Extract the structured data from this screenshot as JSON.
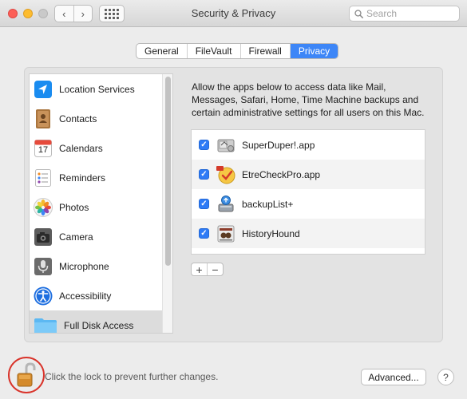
{
  "window": {
    "title": "Security & Privacy",
    "back_label": "‹",
    "forward_label": "›",
    "search_placeholder": "Search"
  },
  "tabs": [
    {
      "label": "General",
      "active": false
    },
    {
      "label": "FileVault",
      "active": false
    },
    {
      "label": "Firewall",
      "active": false
    },
    {
      "label": "Privacy",
      "active": true
    }
  ],
  "sidebar": {
    "selected": "Full Disk Access",
    "items": [
      {
        "label": "Location Services",
        "icon": "location-arrow-icon"
      },
      {
        "label": "Contacts",
        "icon": "contacts-book-icon"
      },
      {
        "label": "Calendars",
        "icon": "calendar-icon"
      },
      {
        "label": "Reminders",
        "icon": "reminders-list-icon"
      },
      {
        "label": "Photos",
        "icon": "photos-flower-icon"
      },
      {
        "label": "Camera",
        "icon": "camera-icon"
      },
      {
        "label": "Microphone",
        "icon": "microphone-icon"
      },
      {
        "label": "Accessibility",
        "icon": "accessibility-icon"
      },
      {
        "label": "Full Disk Access",
        "icon": "folder-icon"
      }
    ]
  },
  "calendar_icon_day": "17",
  "description": "Allow the apps below to access data like Mail, Messages, Safari, Home, Time Machine backups and certain administrative settings for all users on this Mac.",
  "apps": [
    {
      "name": "SuperDuper!.app",
      "checked": true,
      "icon": "superduper-app-icon"
    },
    {
      "name": "EtreCheckPro.app",
      "checked": true,
      "icon": "etrecheck-app-icon"
    },
    {
      "name": "backupList+",
      "checked": true,
      "icon": "backuplist-app-icon"
    },
    {
      "name": "HistoryHound",
      "checked": true,
      "icon": "historyhound-app-icon"
    }
  ],
  "add_label": "+",
  "remove_label": "−",
  "lock_text": "Click the lock to prevent further changes.",
  "advanced_label": "Advanced...",
  "help_label": "?",
  "colors": {
    "accent": "#3d86f7",
    "lock_highlight": "#d9342b"
  }
}
